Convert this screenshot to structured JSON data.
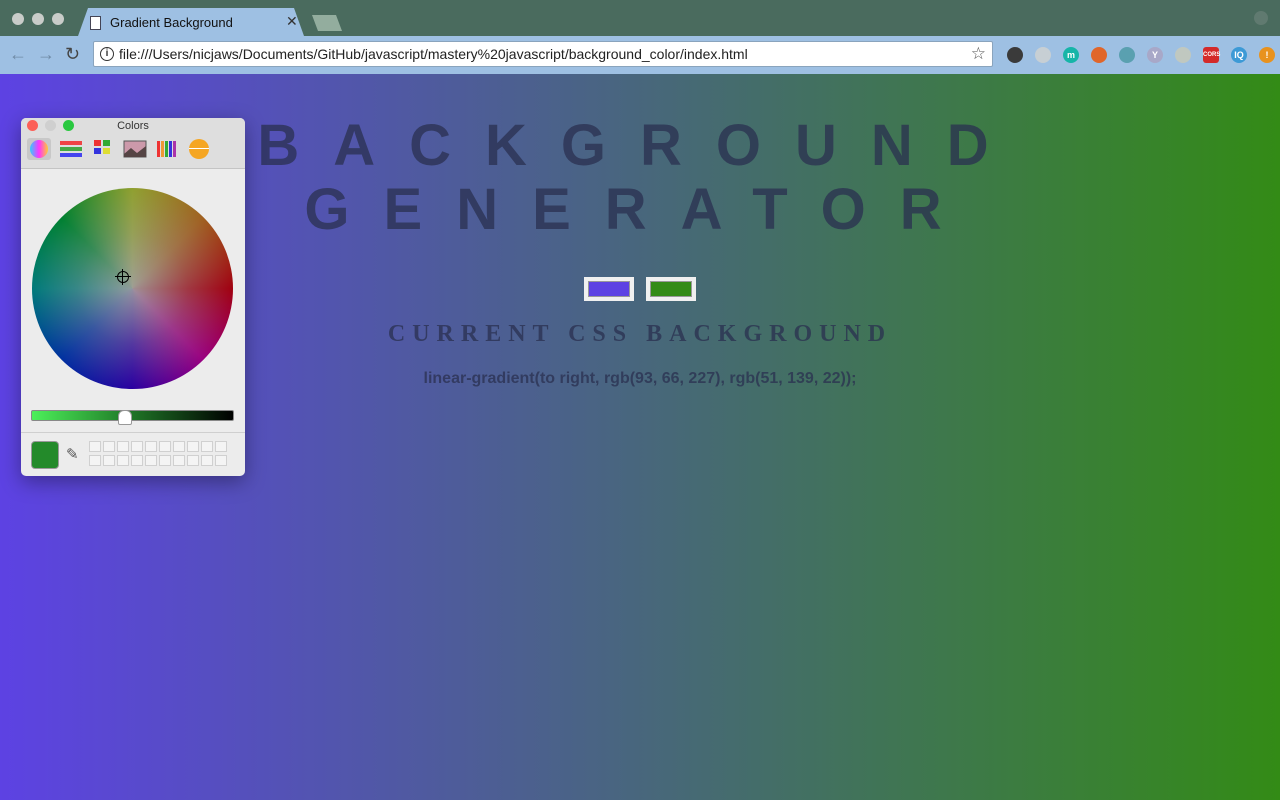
{
  "browser": {
    "tab_title": "Gradient Background",
    "url": "file:///Users/nicjaws/Documents/GitHub/javascript/mastery%20javascript/background_color/index.html",
    "extensions": [
      {
        "name": "eyedropper-extension-icon",
        "glyph": "",
        "color": "#3a3a3a"
      },
      {
        "name": "sync-extension-icon",
        "glyph": "",
        "color": "#c7cfd4"
      },
      {
        "name": "m-extension-icon",
        "glyph": "m",
        "color": "#16b5a8"
      },
      {
        "name": "fire-extension-icon",
        "glyph": "",
        "color": "#e0662a"
      },
      {
        "name": "react-extension-icon",
        "glyph": "",
        "color": "#5aa0b0"
      },
      {
        "name": "y-extension-icon",
        "glyph": "Y",
        "color": "#a8a8c8"
      },
      {
        "name": "target-extension-icon",
        "glyph": "",
        "color": "#c0c8c0"
      },
      {
        "name": "cors-extension-icon",
        "glyph": "CORS",
        "color": "#d42a2a"
      },
      {
        "name": "iq-extension-icon",
        "glyph": "IQ",
        "color": "#3d9ad6"
      },
      {
        "name": "alert-extension-icon",
        "glyph": "!",
        "color": "#e8921e"
      }
    ]
  },
  "page": {
    "title_line1": "BACKGROUND",
    "title_line2": "GENERATOR",
    "subtitle": "CURRENT CSS BACKGROUND",
    "css_text": "linear-gradient(to right, rgb(93, 66, 227), rgb(51, 139, 22));",
    "color1": "#5d42e3",
    "color2": "#338b16"
  },
  "colors_panel": {
    "title": "Colors",
    "current_color": "#238a2a"
  }
}
